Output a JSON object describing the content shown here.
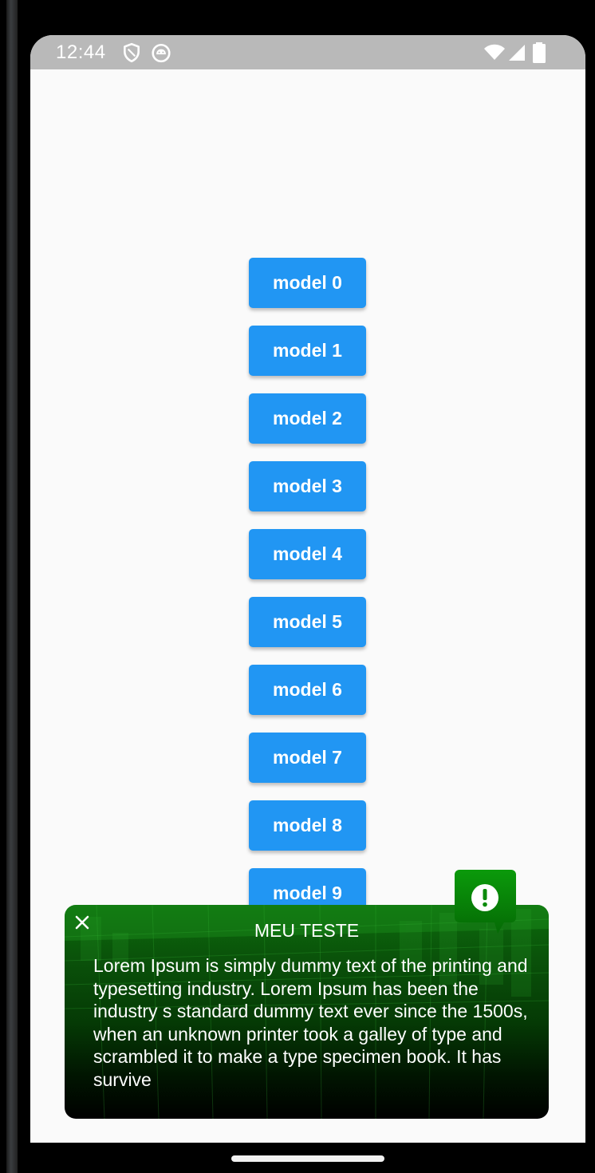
{
  "status_bar": {
    "time": "12:44",
    "icons": [
      "shield-icon",
      "android-debug-icon",
      "wifi-icon",
      "cellular-signal-icon",
      "battery-icon"
    ],
    "background_color": "#b9b9b9"
  },
  "buttons": [
    {
      "label": "model 0"
    },
    {
      "label": "model 1"
    },
    {
      "label": "model 2"
    },
    {
      "label": "model 3"
    },
    {
      "label": "model 4"
    },
    {
      "label": "model 5"
    },
    {
      "label": "model 6"
    },
    {
      "label": "model 7"
    },
    {
      "label": "model 8"
    },
    {
      "label": "model 9"
    }
  ],
  "button_color": "#2196f3",
  "snackbar": {
    "title": "MEU TESTE",
    "body": "Lorem Ipsum is simply dummy text of the printing and typesetting industry. Lorem Ipsum has been the industry s standard dummy text ever since the 1500s, when an unknown printer took a galley of type and scrambled it to make a type specimen book. It has survive",
    "close_icon": "close-icon",
    "badge_icon": "exclamation-circle-icon",
    "accent_color": "#0a8a0a"
  }
}
